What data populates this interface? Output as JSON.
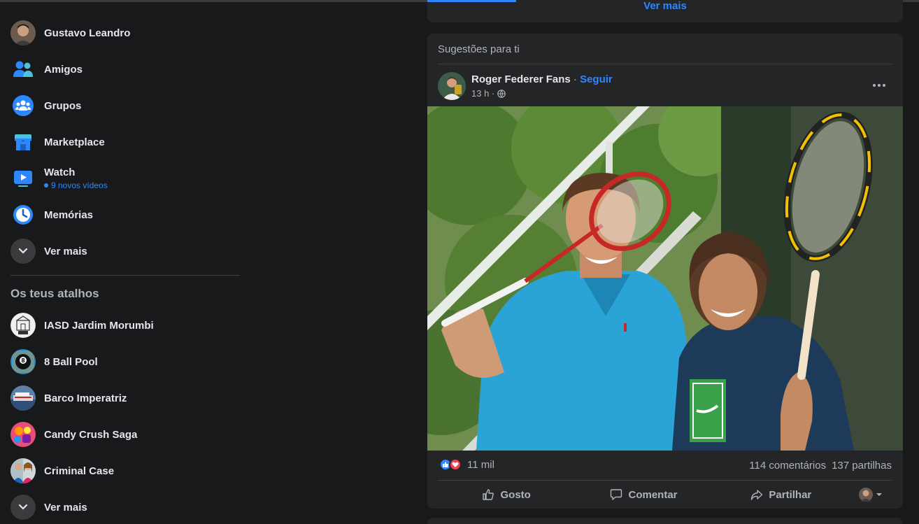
{
  "user": {
    "name": "Gustavo Leandro"
  },
  "sidebar": {
    "items": [
      {
        "label": "Amigos"
      },
      {
        "label": "Grupos"
      },
      {
        "label": "Marketplace"
      },
      {
        "label": "Watch",
        "sub": "9 novos vídeos"
      },
      {
        "label": "Memórias"
      }
    ],
    "see_more": "Ver mais",
    "shortcuts_title": "Os teus atalhos",
    "shortcuts": [
      {
        "label": "IASD Jardim Morumbi"
      },
      {
        "label": "8 Ball Pool"
      },
      {
        "label": "Barco Imperatriz"
      },
      {
        "label": "Candy Crush Saga"
      },
      {
        "label": "Criminal Case"
      }
    ],
    "shortcuts_see_more": "Ver mais"
  },
  "feed": {
    "top_card_link": "Ver mais",
    "suggestions": {
      "title": "Sugestões para ti",
      "post": {
        "author": "Roger Federer Fans",
        "separator": "·",
        "follow": "Seguir",
        "time": "13 h ·",
        "reactions_count": "11 mil",
        "comments": "114 comentários",
        "shares": "137 partilhas",
        "actions": {
          "like": "Gosto",
          "comment": "Comentar",
          "share": "Partilhar"
        }
      }
    }
  },
  "colors": {
    "background": "#18191a",
    "card": "#242526",
    "accent": "#2d88ff",
    "text_primary": "#e4e6eb",
    "text_secondary": "#b0b3b8"
  },
  "icons": [
    "friends-icon",
    "groups-icon",
    "marketplace-icon",
    "watch-icon",
    "memories-icon",
    "chevron-down-icon",
    "globe-icon",
    "more-options-icon",
    "like-icon",
    "comment-icon",
    "share-icon",
    "love-reaction-icon",
    "like-reaction-icon"
  ]
}
